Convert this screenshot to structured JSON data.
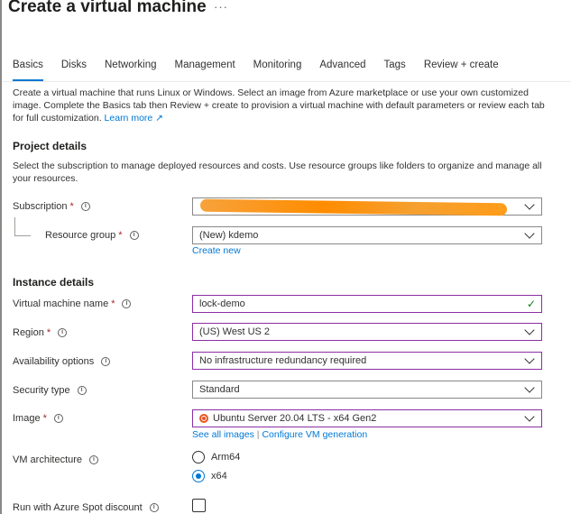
{
  "page": {
    "title": "Create a virtual machine",
    "more": "···"
  },
  "tabs": [
    {
      "label": "Basics",
      "active": true
    },
    {
      "label": "Disks"
    },
    {
      "label": "Networking"
    },
    {
      "label": "Management"
    },
    {
      "label": "Monitoring"
    },
    {
      "label": "Advanced"
    },
    {
      "label": "Tags"
    },
    {
      "label": "Review + create"
    }
  ],
  "intro": {
    "text": "Create a virtual machine that runs Linux or Windows. Select an image from Azure marketplace or use your own customized image. Complete the Basics tab then Review + create to provision a virtual machine with default parameters or review each tab for full customization.",
    "link": "Learn more ↗"
  },
  "project": {
    "heading": "Project details",
    "description": "Select the subscription to manage deployed resources and costs. Use resource groups like folders to organize and manage all your resources.",
    "subscription_label": "Subscription",
    "resource_group_label": "Resource group",
    "resource_group_value": "(New) kdemo",
    "create_new": "Create new"
  },
  "instance": {
    "heading": "Instance details",
    "vm_name_label": "Virtual machine name",
    "vm_name_value": "lock-demo",
    "region_label": "Region",
    "region_value": "(US) West US 2",
    "availability_label": "Availability options",
    "availability_value": "No infrastructure redundancy required",
    "security_label": "Security type",
    "security_value": "Standard",
    "image_label": "Image",
    "image_value": "Ubuntu Server 20.04 LTS - x64 Gen2",
    "see_all_images": "See all images",
    "separator": "|",
    "configure_vm": "Configure VM generation",
    "arch_label": "VM architecture",
    "arch_options": [
      "Arm64",
      "x64"
    ],
    "arch_selected": "x64",
    "spot_label": "Run with Azure Spot discount"
  },
  "symbols": {
    "required": "*",
    "info": "i",
    "check": "✓"
  },
  "colors": {
    "accent": "#0078d4",
    "required": "#a4262c",
    "validated_border": "#8b2fa3",
    "redaction": "#ff8c00"
  }
}
